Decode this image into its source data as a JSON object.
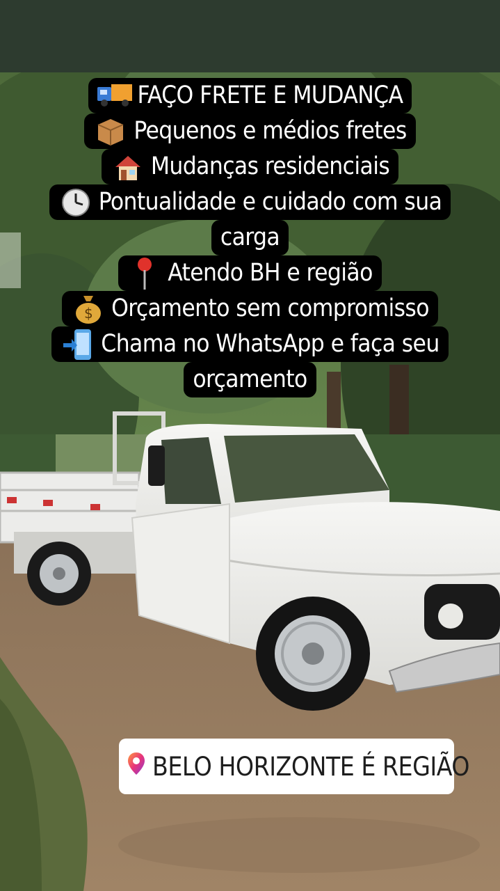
{
  "story": {
    "caption_lines": [
      {
        "icon": "truck-icon",
        "text": "FAÇO FRETE E MUDANÇA"
      },
      {
        "icon": "package-icon",
        "text": "Pequenos e médios fretes"
      },
      {
        "icon": "house-icon",
        "text": "Mudanças residenciais"
      },
      {
        "icon": "clock-icon",
        "text": "Pontualidade e cuidado com sua"
      },
      {
        "icon": "",
        "text": "carga"
      },
      {
        "icon": "pin-icon",
        "text": "Atendo BH e região"
      },
      {
        "icon": "money-bag-icon",
        "text": "Orçamento sem compromisso"
      },
      {
        "icon": "phone-arrow-icon",
        "text": "Chama no WhatsApp e faça seu"
      },
      {
        "icon": "",
        "text": "orçamento"
      }
    ],
    "location_sticker": {
      "icon": "location-pin-icon",
      "text": "BELO HORIZONTE  É REGIÃO"
    }
  },
  "colors": {
    "top_bar": "#2d3b2f",
    "caption_bg": "#000000",
    "caption_text": "#ffffff",
    "sticker_bg": "#ffffff"
  }
}
